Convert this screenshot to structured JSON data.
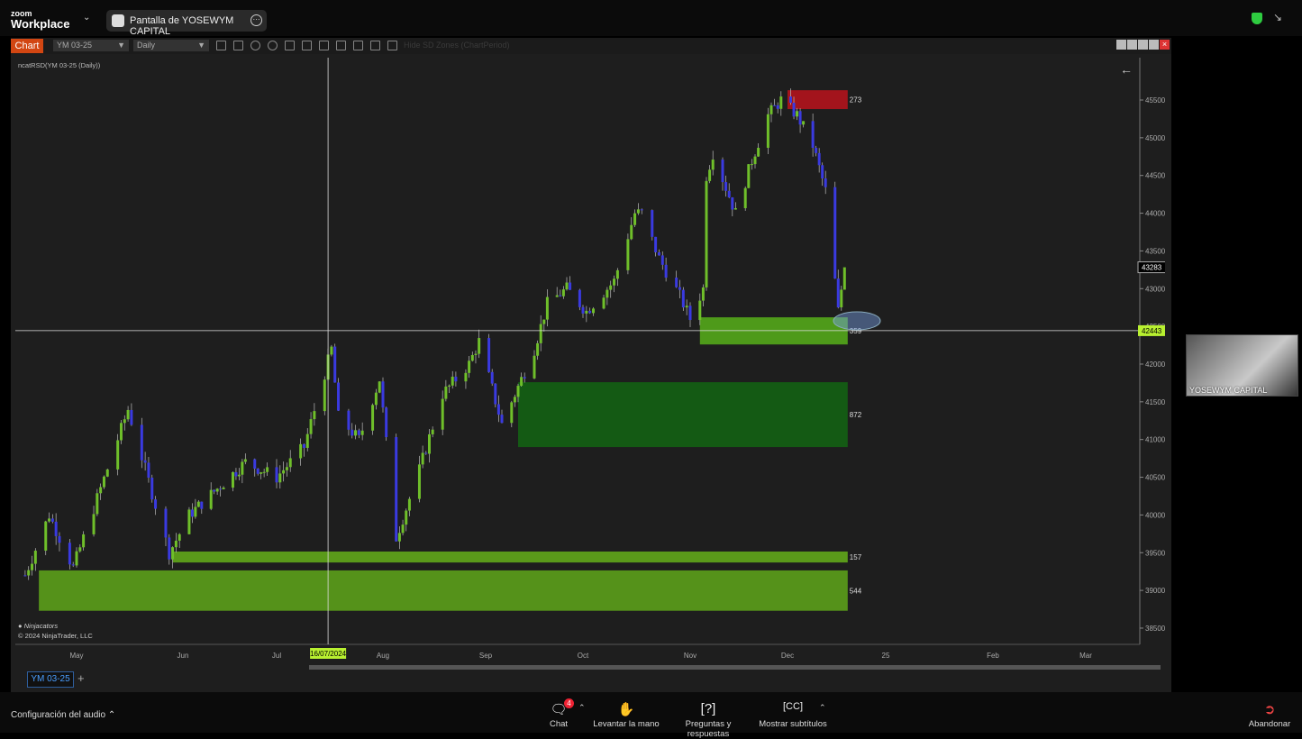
{
  "zoom": {
    "app_small": "zoom",
    "app_name": "Workplace",
    "share_title": "Pantalla de YOSEWYM CAPITAL",
    "participant": "YOSEWYM CAPITAL",
    "audio_settings": "Configuración del audio",
    "toolbar": [
      {
        "label": "Chat",
        "icon": "chat-icon",
        "badge": "4"
      },
      {
        "label": "Levantar la mano",
        "icon": "hand-icon"
      },
      {
        "label": "Preguntas y respuestas",
        "icon": "question-icon"
      },
      {
        "label": "Mostrar subtítulos",
        "icon": "cc-icon"
      }
    ],
    "leave": "Abandonar"
  },
  "ninja": {
    "chart_button": "Chart",
    "instrument": "YM 03-25",
    "period": "Daily",
    "hide_zones": "Hide SD Zones (ChartPeriod)",
    "indicator_label": "ncatRSD(YM 03-25 (Daily))",
    "watermark": "Ninjacators",
    "copyright": "© 2024 NinjaTrader, LLC",
    "tab": "YM 03-25",
    "up_color": "#6fbf2a",
    "down_color": "#3a3ae0"
  },
  "chart_data": {
    "type": "candlestick",
    "y_ticks": [
      "45500",
      "45000",
      "44500",
      "44000",
      "43500",
      "43000",
      "42500",
      "42000",
      "41500",
      "41000",
      "40500",
      "40000",
      "39500",
      "39000",
      "38500"
    ],
    "ylim": [
      38500,
      45500
    ],
    "x_ticks": [
      {
        "label": "May",
        "date": "2024-05-01"
      },
      {
        "label": "Jun",
        "date": "2024-06-01"
      },
      {
        "label": "Jul",
        "date": "2024-07-01"
      },
      {
        "label": "Aug",
        "date": "2024-08-01"
      },
      {
        "label": "Sep",
        "date": "2024-09-01"
      },
      {
        "label": "Oct",
        "date": "2024-10-01"
      },
      {
        "label": "Nov",
        "date": "2024-11-01"
      },
      {
        "label": "Dec",
        "date": "2024-12-01"
      },
      {
        "label": "25",
        "date": "2025-01-01"
      },
      {
        "label": "Feb",
        "date": "2025-02-01"
      },
      {
        "label": "Mar",
        "date": "2025-03-01"
      }
    ],
    "price_path": [
      [
        "2024-04-16",
        39200
      ],
      [
        "2024-04-23",
        40000
      ],
      [
        "2024-04-30",
        39300
      ],
      [
        "2024-05-16",
        41400
      ],
      [
        "2024-05-28",
        39500
      ],
      [
        "2024-06-03",
        40000
      ],
      [
        "2024-06-21",
        40700
      ],
      [
        "2024-07-01",
        40500
      ],
      [
        "2024-07-09",
        40900
      ],
      [
        "2024-07-17",
        42200
      ],
      [
        "2024-07-19",
        41300
      ],
      [
        "2024-07-25",
        41000
      ],
      [
        "2024-07-31",
        41800
      ],
      [
        "2024-08-05",
        39700
      ],
      [
        "2024-08-12",
        40600
      ],
      [
        "2024-08-19",
        41600
      ],
      [
        "2024-08-27",
        42000
      ],
      [
        "2024-08-30",
        42300
      ],
      [
        "2024-09-06",
        41200
      ],
      [
        "2024-09-11",
        41700
      ],
      [
        "2024-09-16",
        42200
      ],
      [
        "2024-09-20",
        42800
      ],
      [
        "2024-09-26",
        43000
      ],
      [
        "2024-10-02",
        42700
      ],
      [
        "2024-10-10",
        43100
      ],
      [
        "2024-10-16",
        44000
      ],
      [
        "2024-10-18",
        44000
      ],
      [
        "2024-10-23",
        43400
      ],
      [
        "2024-10-29",
        42900
      ],
      [
        "2024-11-01",
        42600
      ],
      [
        "2024-11-05",
        43000
      ],
      [
        "2024-11-06",
        44500
      ],
      [
        "2024-11-08",
        44800
      ],
      [
        "2024-11-15",
        44000
      ],
      [
        "2024-11-20",
        44700
      ],
      [
        "2024-11-25",
        45300
      ],
      [
        "2024-11-29",
        45500
      ],
      [
        "2024-12-04",
        45300
      ],
      [
        "2024-12-09",
        44900
      ],
      [
        "2024-12-13",
        44300
      ],
      [
        "2024-12-17",
        42700
      ],
      [
        "2024-12-19",
        43283
      ]
    ],
    "zones": [
      {
        "label": "273",
        "top": 45630,
        "bottom": 45380,
        "start": "2024-12-01",
        "end": "2024-12-20",
        "color": "#a3141c"
      },
      {
        "label": "359",
        "top": 42620,
        "bottom": 42260,
        "start": "2024-11-04",
        "end": "2024-12-20",
        "color": "#4e9a1a"
      },
      {
        "label": "872",
        "top": 41760,
        "bottom": 40900,
        "start": "2024-09-11",
        "end": "2024-12-20",
        "color": "#145a14"
      },
      {
        "label": "157",
        "top": 39515,
        "bottom": 39370,
        "start": "2024-05-29",
        "end": "2024-12-20",
        "color": "#5a9a1a"
      },
      {
        "label": "544",
        "top": 39265,
        "bottom": 38730,
        "start": "2024-04-20",
        "end": "2024-12-20",
        "color": "#55921a"
      }
    ],
    "last_price": "43283",
    "crosshair": {
      "date_label": "16/07/2024",
      "date": "2024-07-16",
      "price": "42443"
    }
  }
}
